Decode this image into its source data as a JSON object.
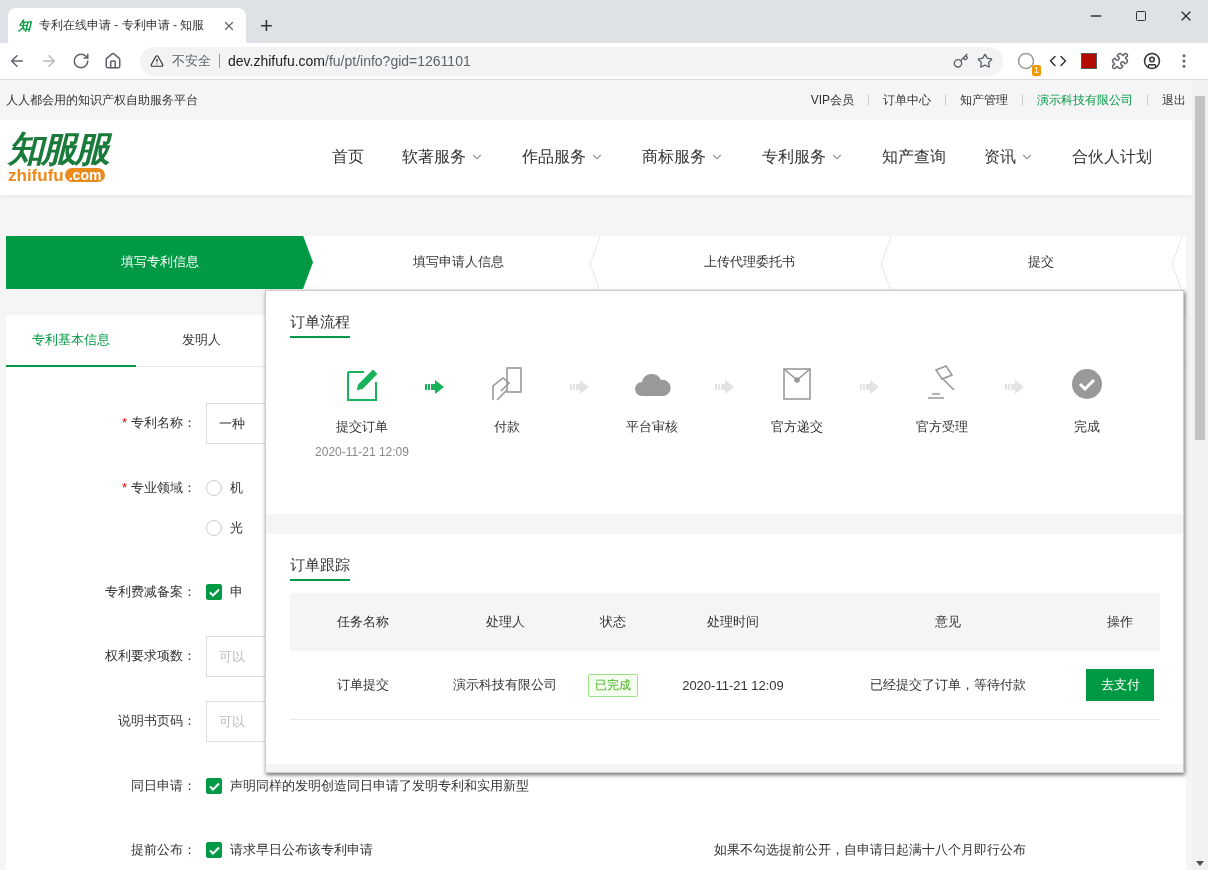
{
  "browser": {
    "favicon": "知",
    "tab_title": "专利在线申请 - 专利申请 - 知服",
    "new_tab": "+",
    "security": "不安全",
    "url_host": "dev.zhifufu.com",
    "url_path": "/fu/pt/info?gid=1261101",
    "extension_badge": "1"
  },
  "topbar": {
    "slogan": "人人都会用的知识产权自助服务平台",
    "links": [
      {
        "label": "VIP会员",
        "highlight": false
      },
      {
        "label": "订单中心",
        "highlight": false
      },
      {
        "label": "知产管理",
        "highlight": false
      },
      {
        "label": "演示科技有限公司",
        "highlight": true
      },
      {
        "label": "退出",
        "highlight": false
      }
    ]
  },
  "header": {
    "logo_cn": "知服服",
    "logo_en": "zhifufu",
    "logo_domain": ".com",
    "nav": [
      {
        "label": "首页",
        "dropdown": false
      },
      {
        "label": "软著服务",
        "dropdown": true
      },
      {
        "label": "作品服务",
        "dropdown": true
      },
      {
        "label": "商标服务",
        "dropdown": true
      },
      {
        "label": "专利服务",
        "dropdown": true
      },
      {
        "label": "知产查询",
        "dropdown": false
      },
      {
        "label": "资讯",
        "dropdown": true
      },
      {
        "label": "合伙人计划",
        "dropdown": false
      }
    ]
  },
  "steps": [
    {
      "label": "填写专利信息",
      "selected": true
    },
    {
      "label": "填写申请人信息",
      "selected": false
    },
    {
      "label": "上传代理委托书",
      "selected": false
    },
    {
      "label": "提交",
      "selected": false
    }
  ],
  "required_mark": "*",
  "form_tabs": [
    {
      "label": "专利基本信息",
      "selected": true
    },
    {
      "label": "发明人",
      "selected": false
    }
  ],
  "fields": [
    {
      "kind": "input",
      "label": "专利名称：",
      "required": true,
      "value": "一种"
    },
    {
      "kind": "radio",
      "label": "专业领域：",
      "required": true,
      "options": [
        {
          "label": "机",
          "checked": false
        },
        {
          "label": "光",
          "checked": false
        }
      ]
    },
    {
      "kind": "checkbox",
      "label": "专利费减备案：",
      "required": false,
      "checked": true,
      "text": "申"
    },
    {
      "kind": "input",
      "label": "权利要求项数：",
      "required": false,
      "placeholder": "可以"
    },
    {
      "kind": "input",
      "label": "说明书页码：",
      "required": false,
      "placeholder": "可以"
    },
    {
      "kind": "checkbox",
      "label": "同日申请：",
      "required": false,
      "checked": true,
      "text": "声明同样的发明创造同日申请了发明专利和实用新型"
    },
    {
      "kind": "checkbox",
      "label": "提前公布：",
      "required": false,
      "checked": true,
      "text": "请求早日公布该专利申请",
      "note": "如果不勾选提前公开，自申请日起满十八个月即行公布"
    }
  ],
  "popup": {
    "flow_title": "订单流程",
    "flow": [
      {
        "label": "提交订单",
        "time": "2020-11-21 12:09",
        "done": true
      },
      {
        "label": "付款",
        "done": false
      },
      {
        "label": "平台审核",
        "done": false
      },
      {
        "label": "官方递交",
        "done": false
      },
      {
        "label": "官方受理",
        "done": false
      },
      {
        "label": "完成",
        "done": false
      }
    ],
    "tracking_title": "订单跟踪",
    "columns": [
      "任务名称",
      "处理人",
      "状态",
      "处理时间",
      "意见",
      "操作"
    ],
    "rows": [
      {
        "task": "订单提交",
        "handler": "演示科技有限公司",
        "status": "已完成",
        "time": "2020-11-21 12:09",
        "opinion": "已经提交了订单，等待付款",
        "action": "去支付"
      }
    ]
  }
}
